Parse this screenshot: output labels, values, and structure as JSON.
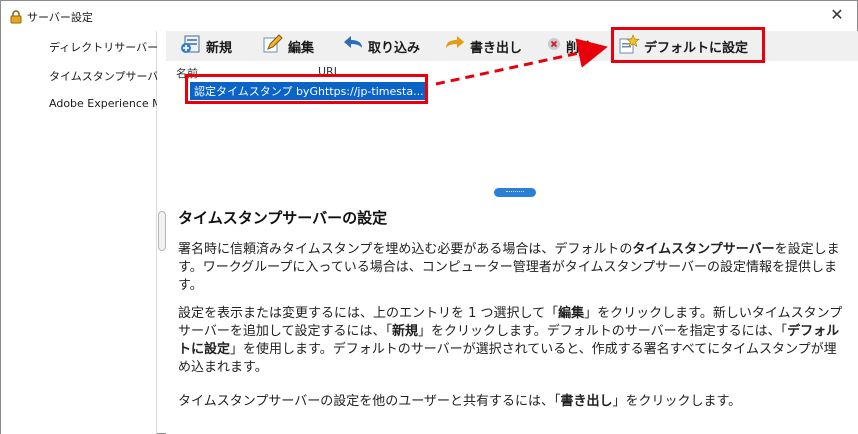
{
  "window": {
    "title": "サーバー設定"
  },
  "sidebar": {
    "items": [
      {
        "label": "ディレクトリサーバー"
      },
      {
        "label": "タイムスタンプサーバー"
      },
      {
        "label": "Adobe Experience Manager"
      }
    ]
  },
  "toolbar": {
    "new_label": "新規",
    "edit_label": "編集",
    "import_label": "取り込み",
    "export_label": "書き出し",
    "delete_label": "削除",
    "default_label": "デフォルトに設定"
  },
  "list": {
    "columns": [
      "名前",
      "URL"
    ],
    "rows": [
      {
        "name": "認定タイムスタンプ byG...",
        "url": "https://jp-timesta..."
      }
    ]
  },
  "help": {
    "heading": "タイムスタンプサーバーの設定",
    "p1_a": "署名時に信頼済みタイムスタンプを埋め込む必要がある場合は、デフォルトの",
    "p1_b": "タイムスタンプサーバー",
    "p1_c": "を設定します。ワークグループに入っている場合は、コンピューター管理者がタイムスタンプサーバーの設定情報を提供します。",
    "p2_a": "設定を表示または変更するには、上のエントリを 1 つ選択して「",
    "p2_b": "編集",
    "p2_c": "」をクリックします。新しいタイムスタンプサーバーを追加して設定するには、「",
    "p2_d": "新規",
    "p2_e": "」をクリックします。デフォルトのサーバーを指定するには、「",
    "p2_f": "デフォルトに設定",
    "p2_g": "」を使用します。デフォルトのサーバーが選択されていると、作成する署名すべてにタイムスタンプが埋め込まれます。",
    "p3_a": "タイムスタンプサーバーの設定を他のユーザーと共有するには、「",
    "p3_b": "書き出し",
    "p3_c": "」をクリックします。"
  },
  "colors": {
    "highlight": "#e8000b",
    "selection": "#0a64c8",
    "toolbar_bg": "#f0f0f0"
  }
}
